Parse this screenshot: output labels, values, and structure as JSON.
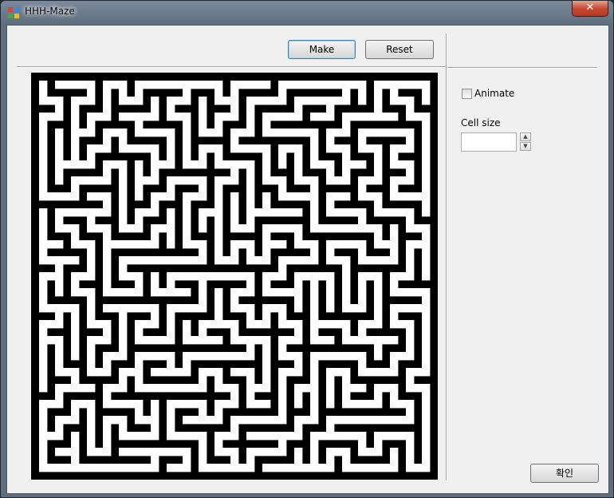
{
  "window": {
    "title": "HHH-Maze",
    "close_label": "✕"
  },
  "toolbar": {
    "make_label": "Make",
    "reset_label": "Reset"
  },
  "options": {
    "animate_label": "Animate",
    "animate_checked": false,
    "cell_size_label": "Cell size",
    "cell_size_value": ""
  },
  "footer": {
    "ok_label": "확인"
  },
  "icons": {
    "app": "maze-app-icon",
    "spin_up": "spin-up-icon",
    "spin_down": "spin-down-icon"
  },
  "maze": {
    "cols": 25,
    "rows": 25,
    "wall_color": "#000000",
    "path_color": "#ffffff",
    "seed": 20240101
  }
}
